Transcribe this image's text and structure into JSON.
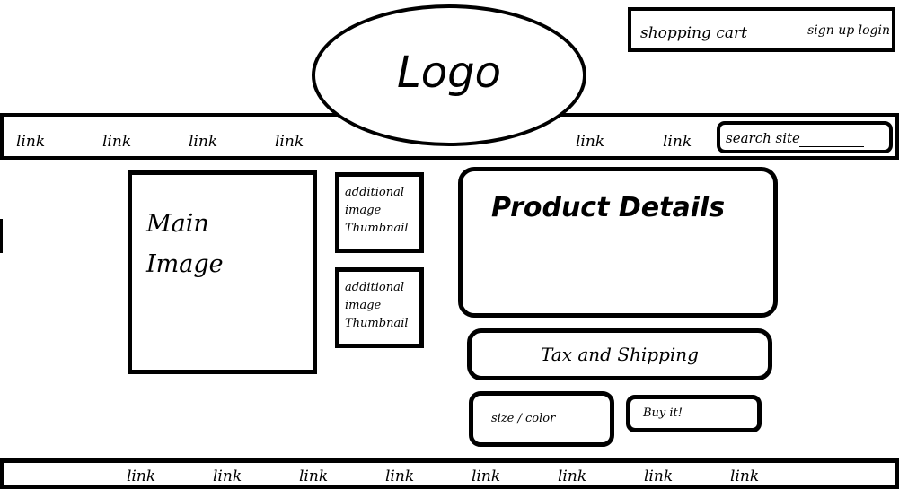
{
  "header": {
    "shopping_cart": "shopping cart",
    "auth": "sign up login",
    "logo": "Logo"
  },
  "nav": {
    "links": [
      "link",
      "link",
      "link",
      "link",
      "link",
      "link"
    ],
    "search_placeholder": "search site"
  },
  "product": {
    "main_image": "Main\nImage",
    "thumbnails": [
      "additional\nimage\nThumbnail",
      "additional\nimage\nThumbnail"
    ],
    "details": "Product Details",
    "tax_shipping": "Tax and Shipping",
    "size_color": "size / color",
    "buy": "Buy it!"
  },
  "footer": {
    "links": [
      "link",
      "link",
      "link",
      "link",
      "link",
      "link",
      "link",
      "link"
    ]
  }
}
